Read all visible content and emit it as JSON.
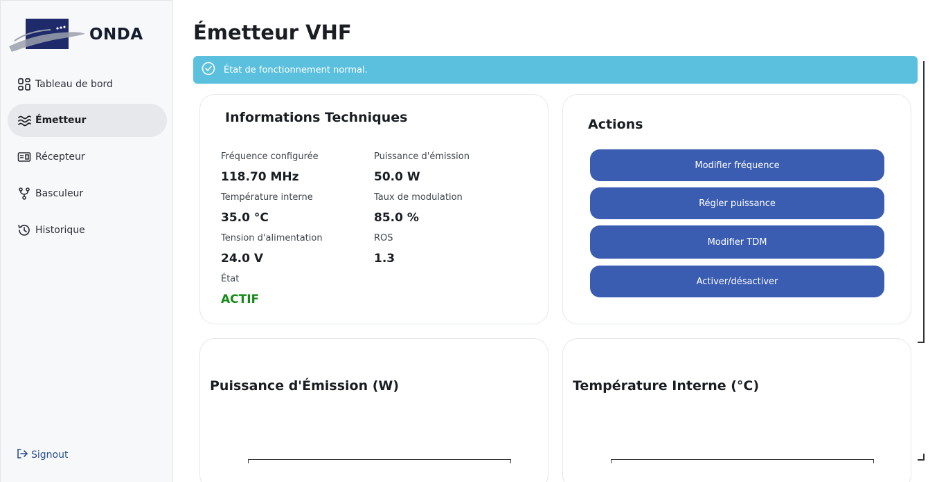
{
  "sidebar": {
    "brand": "ONDA",
    "items": [
      {
        "label": "Tableau de bord",
        "icon": "dashboard-icon"
      },
      {
        "label": "Émetteur",
        "icon": "waves-icon"
      },
      {
        "label": "Récepteur",
        "icon": "receiver-icon"
      },
      {
        "label": "Basculeur",
        "icon": "fork-icon"
      },
      {
        "label": "Historique",
        "icon": "history-icon"
      }
    ],
    "signout": "Signout"
  },
  "page": {
    "title": "Émetteur VHF"
  },
  "alert": {
    "text": "État de fonctionnement normal.",
    "color": "#5bc0de"
  },
  "info": {
    "title": "Informations Techniques",
    "fields": [
      {
        "label": "Fréquence configurée",
        "value": "118.70 MHz"
      },
      {
        "label": "Puissance d'émission",
        "value": "50.0 W"
      },
      {
        "label": "Température interne",
        "value": "35.0 °C"
      },
      {
        "label": "Taux de modulation",
        "value": "85.0 %"
      },
      {
        "label": "Tension d'alimentation",
        "value": "24.0 V"
      },
      {
        "label": "ROS",
        "value": "1.3"
      },
      {
        "label": "État",
        "value": "ACTIF"
      }
    ]
  },
  "actions": {
    "title": "Actions",
    "buttons": [
      "Modifier fréquence",
      "Régler puissance",
      "Modifier TDM",
      "Activer/désactiver"
    ],
    "button_color": "#3a5db1"
  },
  "charts": [
    {
      "title": "Puissance d'Émission (W)"
    },
    {
      "title": "Température Interne (°C)"
    }
  ]
}
